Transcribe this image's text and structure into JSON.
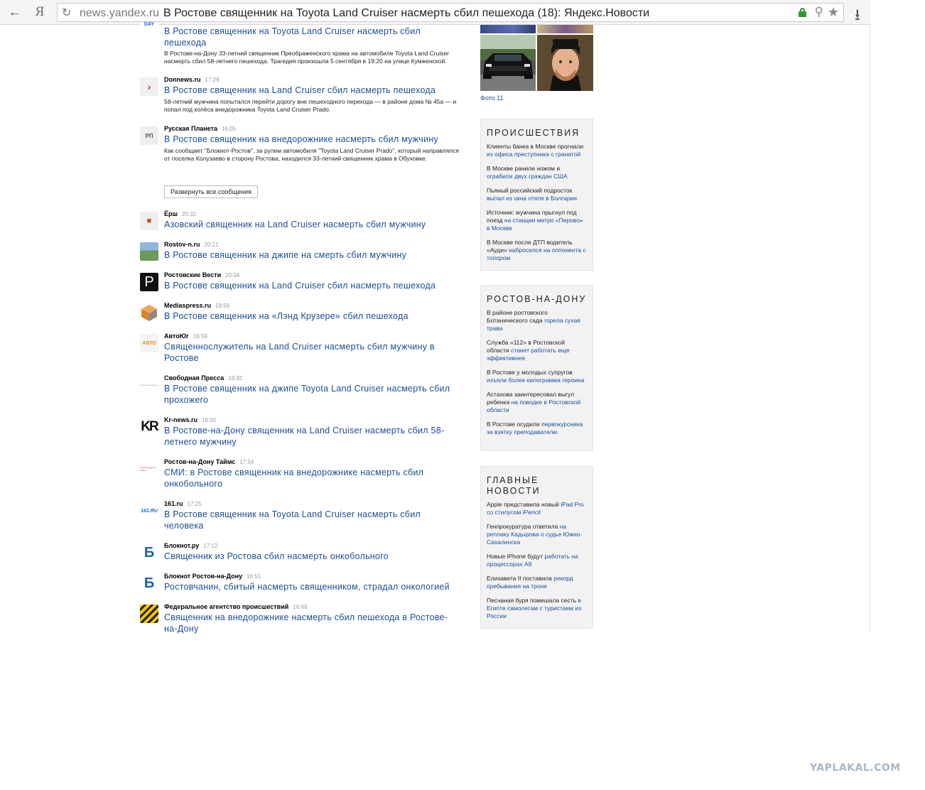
{
  "browser": {
    "back_glyph": "←",
    "yandex_glyph": "Я",
    "reload_glyph": "↻",
    "url": "news.yandex.ru",
    "title": "В Ростове священник на Toyota Land Cruiser насмерть сбил пешехода (18): Яндекс.Новости",
    "zoom_glyph": "⚲",
    "star_glyph": "★",
    "download_glyph": "⭳"
  },
  "main": {
    "top_items": [
      {
        "logo_text": "DAY",
        "source": "",
        "time": "",
        "title": "В Ростове священник на Toyota Land Cruiser насмерть сбил пешехода",
        "snippet": "В Ростове-на-Дону 33-летний священник Преображенского храма на автомобиле Toyota Land Cruiser насмерть сбил 58-летнего пешехода. Трагедия произошла 5 сентября в 19:20 на улице Кумженской."
      },
      {
        "logo_text": "›",
        "source": "Donnews.ru",
        "time": "17:29",
        "title": "В Ростове священник на Land Cruiser сбил насмерть пешехода",
        "snippet": "58-летний мужчина попытался перейти дорогу вне пешеходного перехода — в районе дома № 45а — и попал под колёса внедорожника Toyota Land Cruiser Prado."
      },
      {
        "logo_text": "РП",
        "source": "Русская Планета",
        "time": "16:05",
        "title": "В Ростове священник на внедорожнике насмерть сбил мужчину",
        "snippet": "Как сообщает \"Блокнот-Ростов\", за рулем автомобиля \"Toyota Land Cruiser Prado\", который направлялся от поселка Колузаево в сторону Ростова, находился 33-летний священник храма в Обуховке."
      }
    ],
    "expand_label": "Развернуть все сообщения",
    "items": [
      {
        "logo_text": "■",
        "source": "Ёрш",
        "time": "20:32",
        "title": "Азовский священник на Land Cruiser насмерть сбил мужчину"
      },
      {
        "logo_text": "",
        "source": "Rostov-n.ru",
        "time": "20:21",
        "title": "В Ростове священник на джипе на смерть сбил мужчину"
      },
      {
        "logo_text": "P",
        "source": "Ростовские Вести",
        "time": "20:04",
        "title": "В Ростове священник на Land Cruiser сбил насмерть пешехода"
      },
      {
        "logo_text": "",
        "source": "Mediaspress.ru",
        "time": "19:59",
        "title": "В Ростове священник на «Лэнд Крузере» сбил пешехода"
      },
      {
        "logo_text": "АВТО",
        "source": "АвтоЮг",
        "time": "19:59",
        "title": "Священнослужитель на Land Cruiser насмерть сбил мужчину в Ростове"
      },
      {
        "logo_text": "СвободнаяПресса",
        "source": "Свободная Пресса",
        "time": "19:32",
        "title": "В Ростове священник на джипе Toyota Land Cruiser насмерть сбил прохожего"
      },
      {
        "logo_text": "KR",
        "source": "Kr-news.ru",
        "time": "18:50",
        "title": "В Ростове-на-Дону священник на Land Cruiser насмерть сбил 58-летнего мужчину"
      },
      {
        "logo_text": "Ростов-на-Дону Таймс",
        "source": "Ростов-на-Дону Таймс",
        "time": "17:54",
        "title": "СМИ: в Ростове священник на внедорожнике насмерть сбил онкобольного"
      },
      {
        "logo_text": "161.RU",
        "source": "161.ru",
        "time": "17:25",
        "title": "В Ростове священник на Toyota Land Cruiser насмерть сбил человека"
      },
      {
        "logo_text": "Б",
        "source": "Блокнот.ру",
        "time": "17:12",
        "title": "Священник из Ростова сбил насмерть онкобольного"
      },
      {
        "logo_text": "Б",
        "source": "Блокнот Ростов-на-Дону",
        "time": "16:51",
        "title": "Ростовчанин, сбитый насмерть священником, страдал онкологией"
      },
      {
        "logo_text": "",
        "source": "Федеральное агентство происшествий",
        "time": "16:49",
        "title": "Священник на внедорожнике насмерть сбил пешехода в Ростове-на-Дону"
      }
    ]
  },
  "sidebar": {
    "photo_caption": "Фото 11",
    "boxes": [
      {
        "heading": "ПРОИСШЕСТВИЯ",
        "items": [
          {
            "plain": "Клиенты банка в Москве прогнали ",
            "link": "из офиса преступника с гранатой"
          },
          {
            "plain": "В Москве ранили ножом и ",
            "link": "ограбили двух граждан США"
          },
          {
            "plain": "Пьяный российский подросток ",
            "link": "выпал из окна отеля в Болгарии"
          },
          {
            "plain": "Источник: мужчина прыгнул под поезд ",
            "link": "на станции метро «Перово» в Москве"
          },
          {
            "plain": "В Москве после ДТП водитель «Ауди» ",
            "link": "набросился на оппонента с топором"
          }
        ]
      },
      {
        "heading": "РОСТОВ-НА-ДОНУ",
        "items": [
          {
            "plain": "В районе ростовского Ботанического сада ",
            "link": "горела сухая трава"
          },
          {
            "plain": "Служба «112» в Ростовской области ",
            "link": "станет работать еще эффективнее"
          },
          {
            "plain": "В Ростове у молодых супругов ",
            "link": "изъяли более килограмма героина"
          },
          {
            "plain": "Астахова заинтересовал выгул ребенка ",
            "link": "на поводке в Ростовской области"
          },
          {
            "plain": "В Ростове осудили ",
            "link": "первокурсника за взятку преподавателю"
          }
        ]
      },
      {
        "heading": "ГЛАВНЫЕ НОВОСТИ",
        "items": [
          {
            "plain": "Apple представила новый ",
            "link": "iPad Pro со стилусом iPencil"
          },
          {
            "plain": "Генпрокуратура ответила ",
            "link": "на реплику Кадырова о судье Южно-Сахалинска"
          },
          {
            "plain": "Новые iPhone будут ",
            "link": "работать на процессорах A9"
          },
          {
            "plain": "Елизавета II поставила ",
            "link": "рекорд пребывания на троне"
          },
          {
            "plain": "Песчаная буря помешала сесть ",
            "link": "в Египте самолетам с туристами из России"
          }
        ]
      }
    ]
  },
  "watermark": "YAPLAKAL.COM",
  "colors": {
    "link": "#1a4d99",
    "box_bg": "#f2f2f2",
    "lock_green": "#2a9d2a"
  }
}
